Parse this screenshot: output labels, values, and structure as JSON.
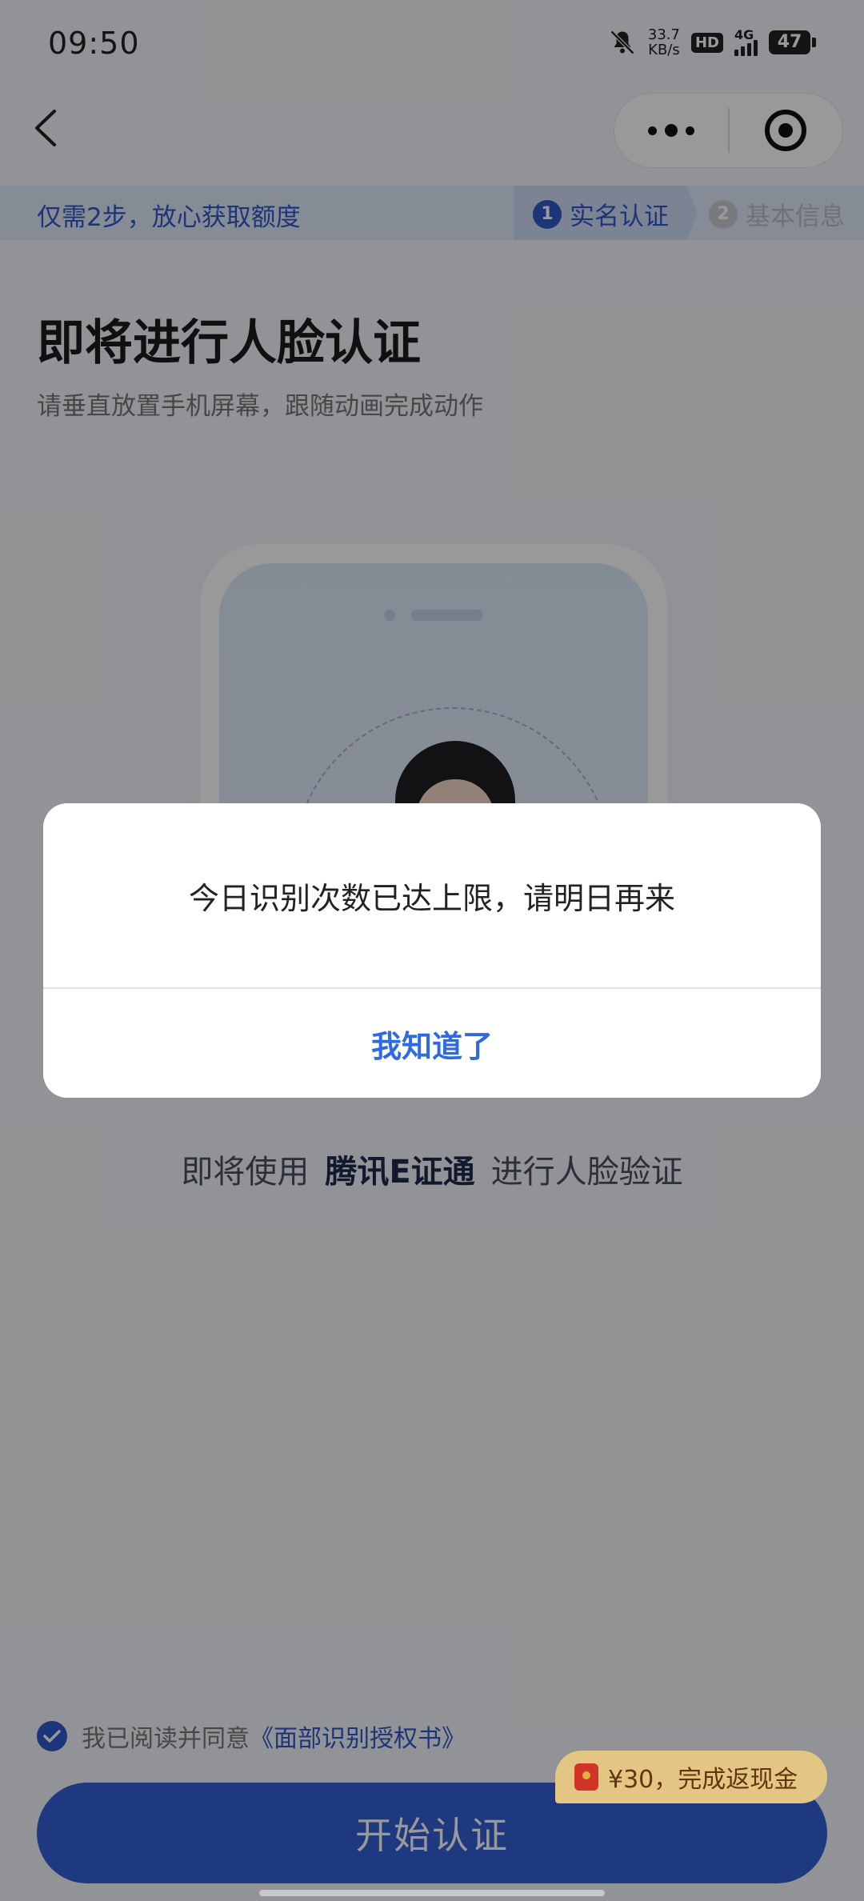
{
  "status_bar": {
    "time": "09:50",
    "net_speed_value": "33.7",
    "net_speed_unit": "KB/s",
    "hd_badge": "HD",
    "network": "4G",
    "battery": "47"
  },
  "step_bar": {
    "text": "仅需2步，放心获取额度",
    "steps": [
      {
        "num": "1",
        "label": "实名认证",
        "active": true
      },
      {
        "num": "2",
        "label": "基本信息",
        "active": false
      }
    ]
  },
  "main": {
    "title": "即将进行人脸认证",
    "subtitle": "请垂直放置手机屏幕，跟随动画完成动作",
    "provider_prefix": "即将使用",
    "provider_name": "腾讯E证通",
    "provider_suffix": "进行人脸验证"
  },
  "agreement": {
    "text": "我已阅读并同意",
    "link": "《面部识别授权书》",
    "checked": true
  },
  "start_button": "开始认证",
  "cashback_badge": "¥30，完成返现金",
  "dialog": {
    "message": "今日识别次数已达上限，请明日再来",
    "button": "我知道了"
  },
  "colors": {
    "accent": "#3460d6",
    "dialog_button": "#2f6ae0",
    "overlay": "rgba(0,0,0,0.40)"
  }
}
